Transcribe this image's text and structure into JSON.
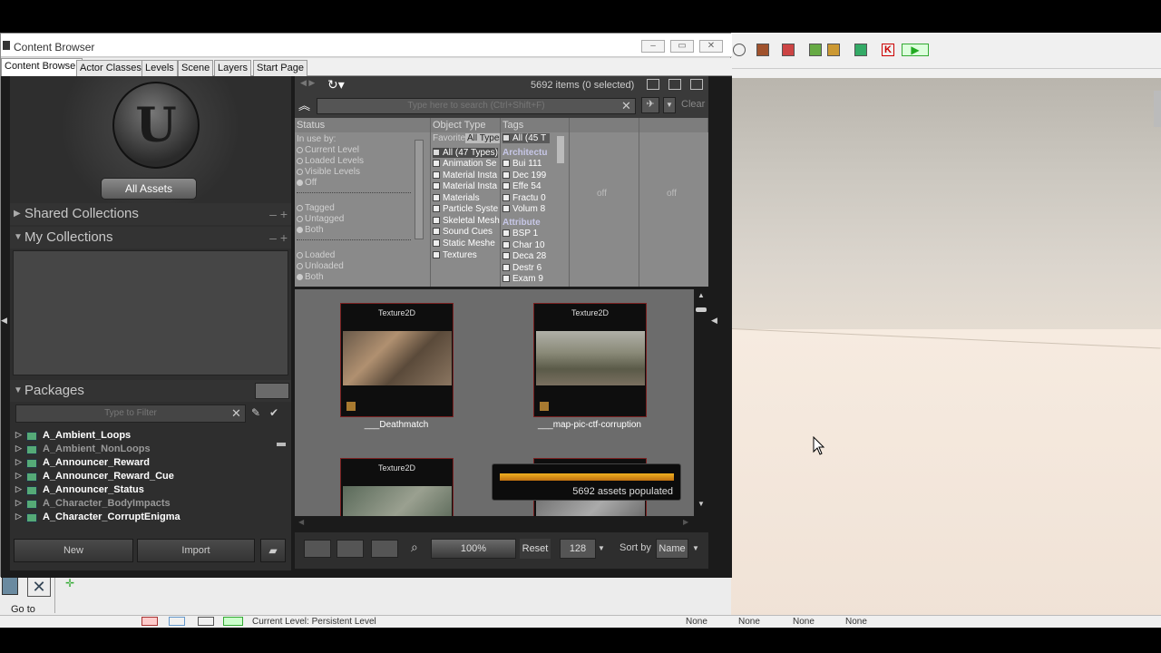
{
  "window": {
    "title": "Content Browser",
    "min_label": "▭",
    "max_label": "▭",
    "close_label": "✕"
  },
  "tabs": [
    "Content Browser",
    "Actor Classes",
    "Levels",
    "Scene",
    "Layers",
    "Start Page"
  ],
  "left_panel": {
    "logo_letter": "U",
    "all_assets": "All Assets",
    "shared_collections": "Shared Collections",
    "my_collections": "My Collections",
    "packages": "Packages",
    "package_filter_placeholder": "Type to Filter",
    "packages_list": [
      "A_Ambient_Loops",
      "A_Ambient_NonLoops",
      "A_Announcer_Reward",
      "A_Announcer_Reward_Cue",
      "A_Announcer_Status",
      "A_Character_BodyImpacts",
      "A_Character_CorruptEnigma"
    ],
    "new_button": "New",
    "import_button": "Import"
  },
  "filter_bar": {
    "item_count": "5692 items (0 selected)",
    "search_placeholder": "Type here to search (Ctrl+Shift+F)",
    "clear": "Clear"
  },
  "filters": {
    "status_header": "Status",
    "status_lines": [
      "In use by:",
      "Current Level",
      "Loaded Levels",
      "Visible Levels",
      "Off",
      "Tagged",
      "Untagged",
      "Both",
      "Loaded",
      "Unloaded",
      "Both"
    ],
    "object_type_header": "Object Type",
    "object_type_tabs": [
      "Favorite",
      "All Types"
    ],
    "object_types": [
      "All (47 Types)",
      "Animation Se",
      "Material Insta",
      "Material Insta",
      "Materials",
      "Particle Syste",
      "Skeletal Mesh",
      "Sound Cues",
      "Static Meshe",
      "Textures"
    ],
    "tags_header": "Tags",
    "tags_all": "All (45 T",
    "tag_group_1": "Architectu",
    "tags_1": [
      "Bui 111",
      "Dec 199",
      "Effe 54",
      "Fractu 0",
      "Volum 8"
    ],
    "tag_group_2": "Attribute",
    "tags_2": [
      "BSP 1",
      "Char 10",
      "Deca 28",
      "Destr 6",
      "Exam 9"
    ],
    "off_1": "off",
    "off_2": "off"
  },
  "assets": [
    {
      "type": "Texture2D",
      "name": "___Deathmatch"
    },
    {
      "type": "Texture2D",
      "name": "___map-pic-ctf-corruption"
    },
    {
      "type": "Texture2D",
      "name": ""
    },
    {
      "type": "Texture2D",
      "name": ""
    }
  ],
  "progress": {
    "text": "5692 assets populated",
    "fraction": 0.95
  },
  "bottom_tools": {
    "zoom": "100%",
    "reset": "Reset",
    "thumb_size": "128",
    "sort_by_label": "Sort by",
    "sort_by_value": "Name"
  },
  "editor": {
    "goto_label": "Go to",
    "status_level": "Current Level: Persistent Level",
    "status_fields": [
      "None",
      "None",
      "None",
      "None"
    ]
  }
}
